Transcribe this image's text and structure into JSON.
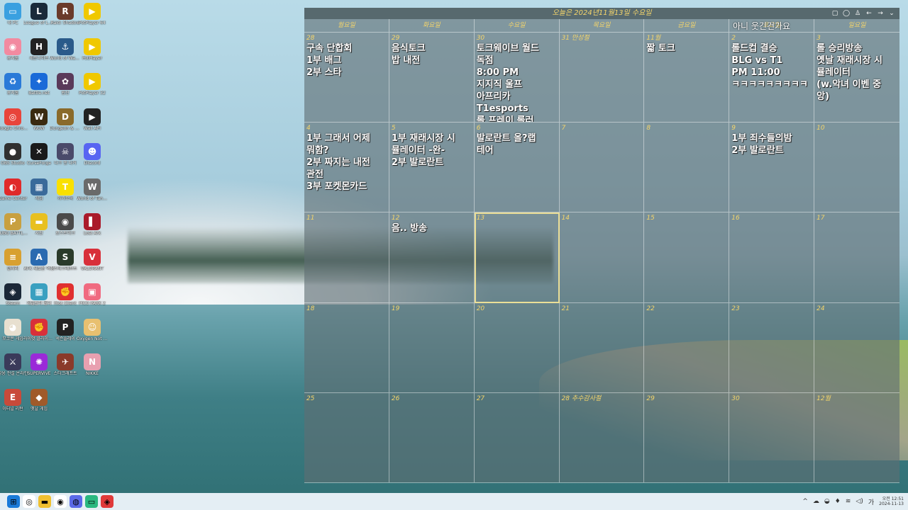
{
  "calendar": {
    "title": "오늘은 2024년11월13일 수요일",
    "weekdays": [
      "월요일",
      "화요일",
      "수요일",
      "목요일",
      "금요일",
      "토요일",
      "일요일"
    ],
    "overlay_text": "아니 웃긴건가요",
    "cells": [
      {
        "num": "28",
        "event": "구속 단합회\n1부 배그\n2부 스타"
      },
      {
        "num": "29",
        "event": "음식토크\n밥 내전"
      },
      {
        "num": "30",
        "event": "토크웨이브 월드\n독점\n8:00 PM\n지지직 울프\n아프리카\nT1esports\n롤 프레이 롤러"
      },
      {
        "num": "31 만성절",
        "event": ""
      },
      {
        "num": "11월",
        "event": "짧 토크"
      },
      {
        "num": "2",
        "event": "롤드컵 결승\nBLG vs T1\nPM 11:00\nㅋㅋㅋㅋㅋㅋㅋㅋㅋ"
      },
      {
        "num": "3",
        "event": "롤 승리방송\n옛날 재래시장 시\n뮬레이터\n(w.악녀 이벤 중\n앙)"
      },
      {
        "num": "4",
        "event": "1부 그래서 어제\n뭐함?\n2부 짜지는 내전\n관전\n3부 포켓몬카드"
      },
      {
        "num": "5",
        "event": "1부 재래시장 시\n뮬레이터 -완-\n2부 발로란트"
      },
      {
        "num": "6",
        "event": "발로란트 올?랩\n테어"
      },
      {
        "num": "7",
        "event": ""
      },
      {
        "num": "8",
        "event": ""
      },
      {
        "num": "9",
        "event": "1부 죄수들의밤\n2부 발로란트"
      },
      {
        "num": "10",
        "event": ""
      },
      {
        "num": "11",
        "event": ""
      },
      {
        "num": "12",
        "event": "음.. 방송"
      },
      {
        "num": "13",
        "event": "",
        "today": true
      },
      {
        "num": "14",
        "event": ""
      },
      {
        "num": "15",
        "event": ""
      },
      {
        "num": "16",
        "event": ""
      },
      {
        "num": "17",
        "event": ""
      },
      {
        "num": "18",
        "event": ""
      },
      {
        "num": "19",
        "event": ""
      },
      {
        "num": "20",
        "event": ""
      },
      {
        "num": "21",
        "event": ""
      },
      {
        "num": "22",
        "event": ""
      },
      {
        "num": "23",
        "event": ""
      },
      {
        "num": "24",
        "event": ""
      },
      {
        "num": "25",
        "event": ""
      },
      {
        "num": "26",
        "event": ""
      },
      {
        "num": "27",
        "event": ""
      },
      {
        "num": "28 추수감사절",
        "event": ""
      },
      {
        "num": "29",
        "event": ""
      },
      {
        "num": "30",
        "event": ""
      },
      {
        "num": "12월",
        "event": ""
      }
    ]
  },
  "desktop_icons": [
    {
      "label": "내 PC",
      "color": "#3aa0e0",
      "glyph": "▭"
    },
    {
      "label": "League of Legends",
      "color": "#1a2a3a",
      "glyph": "L"
    },
    {
      "label": "Raid: Shadow",
      "color": "#6a3a2a",
      "glyph": "R"
    },
    {
      "label": "PotPlayer 64",
      "color": "#f0c800",
      "glyph": "▶"
    },
    {
      "label": "휴지통",
      "color": "#f28aa0",
      "glyph": "◉"
    },
    {
      "label": "세븐나이츠",
      "color": "#222222",
      "glyph": "H"
    },
    {
      "label": "World of Warships",
      "color": "#2a5a8a",
      "glyph": "⚓"
    },
    {
      "label": "PotPlayer",
      "color": "#f0c800",
      "glyph": "▶"
    },
    {
      "label": "휴지통",
      "color": "#2a7ad8",
      "glyph": "♻"
    },
    {
      "label": "Battle.net",
      "color": "#1a6ad8",
      "glyph": "✦"
    },
    {
      "label": "원신",
      "color": "#5a3a5a",
      "glyph": "✿"
    },
    {
      "label": "PotPlayer 32",
      "color": "#f0c800",
      "glyph": "▶"
    },
    {
      "label": "Google Chrome",
      "color": "#e8443a",
      "glyph": "◎"
    },
    {
      "label": "WoW",
      "color": "#3a2a10",
      "glyph": "W"
    },
    {
      "label": "Dungeon & Fighter",
      "color": "#8a6a2a",
      "glyph": "D"
    },
    {
      "label": "Wall API",
      "color": "#222222",
      "glyph": "▶"
    },
    {
      "label": "OBS Studio",
      "color": "#303030",
      "glyph": "●"
    },
    {
      "label": "CurseForge",
      "color": "#1a1a1a",
      "glyph": "✕"
    },
    {
      "label": "다크 앤 다커",
      "color": "#4a4a6a",
      "glyph": "☠"
    },
    {
      "label": "Discord",
      "color": "#5865f2",
      "glyph": "☻"
    },
    {
      "label": "Game Center",
      "color": "#e02a2a",
      "glyph": "◐"
    },
    {
      "label": "게임",
      "color": "#3a6a9a",
      "glyph": "▦"
    },
    {
      "label": "카카오톡",
      "color": "#f9e000",
      "glyph": "T"
    },
    {
      "label": "World of Tanks ASIA",
      "color": "#6a6a6a",
      "glyph": "W"
    },
    {
      "label": "PUBG BATTLEGR",
      "color": "#c8a040",
      "glyph": "P"
    },
    {
      "label": "사진",
      "color": "#e8c020",
      "glyph": "▬"
    },
    {
      "label": "로스트아크",
      "color": "#4a4a4a",
      "glyph": "◉"
    },
    {
      "label": "Lost Ark",
      "color": "#aa1a2a",
      "glyph": "▌"
    },
    {
      "label": "갤러리",
      "color": "#d8a030",
      "glyph": "≡"
    },
    {
      "label": "AFK 새로운 여정",
      "color": "#2a6ab0",
      "glyph": "A"
    },
    {
      "label": "스타크래프트",
      "color": "#2a3a2a",
      "glyph": "S"
    },
    {
      "label": "VALORANT",
      "color": "#d8303a",
      "glyph": "V"
    },
    {
      "label": "Steam",
      "color": "#1b2838",
      "glyph": "◈"
    },
    {
      "label": "게임런처 폴더",
      "color": "#3aa0c0",
      "glyph": "▦"
    },
    {
      "label": "Riot Client",
      "color": "#e03030",
      "glyph": "✊"
    },
    {
      "label": "PICO PARK 2",
      "color": "#f06a80",
      "glyph": "▣"
    },
    {
      "label": "모코몬 게임",
      "color": "#e8e0d0",
      "glyph": "◕"
    },
    {
      "label": "라이엇 클라이언트",
      "color": "#d8303a",
      "glyph": "✊"
    },
    {
      "label": "넥슨플레이",
      "color": "#222222",
      "glyph": "P"
    },
    {
      "label": "Oxygen Not Included",
      "color": "#e8c070",
      "glyph": "☺"
    },
    {
      "label": "영웅 전설 온라인",
      "color": "#3a3a5a",
      "glyph": "⚔"
    },
    {
      "label": "SUPERVIVE",
      "color": "#9a2ad8",
      "glyph": "✺"
    },
    {
      "label": "스타크래프트",
      "color": "#8a3a2a",
      "glyph": "✈"
    },
    {
      "label": "NIKKE",
      "color": "#e8a0b0",
      "glyph": "N"
    },
    {
      "label": "이터널 리턴",
      "color": "#c84a3a",
      "glyph": "E"
    },
    {
      "label": "옛날 게임",
      "color": "#a05a2a",
      "glyph": "◆"
    }
  ],
  "taskbar": {
    "apps": [
      {
        "name": "start",
        "color": "#1a7ad8",
        "glyph": "⊞"
      },
      {
        "name": "chrome",
        "color": "#ffffff",
        "glyph": "◎"
      },
      {
        "name": "explorer",
        "color": "#f0c030",
        "glyph": "▬"
      },
      {
        "name": "chrome-alt",
        "color": "#ffffff",
        "glyph": "◉"
      },
      {
        "name": "app",
        "color": "#5a6ae8",
        "glyph": "◍"
      },
      {
        "name": "app2",
        "color": "#2ab880",
        "glyph": "▭"
      },
      {
        "name": "app3",
        "color": "#e03a3a",
        "glyph": "◈"
      }
    ],
    "clock_time": "오전 12:51",
    "clock_date": "2024-11-13"
  }
}
